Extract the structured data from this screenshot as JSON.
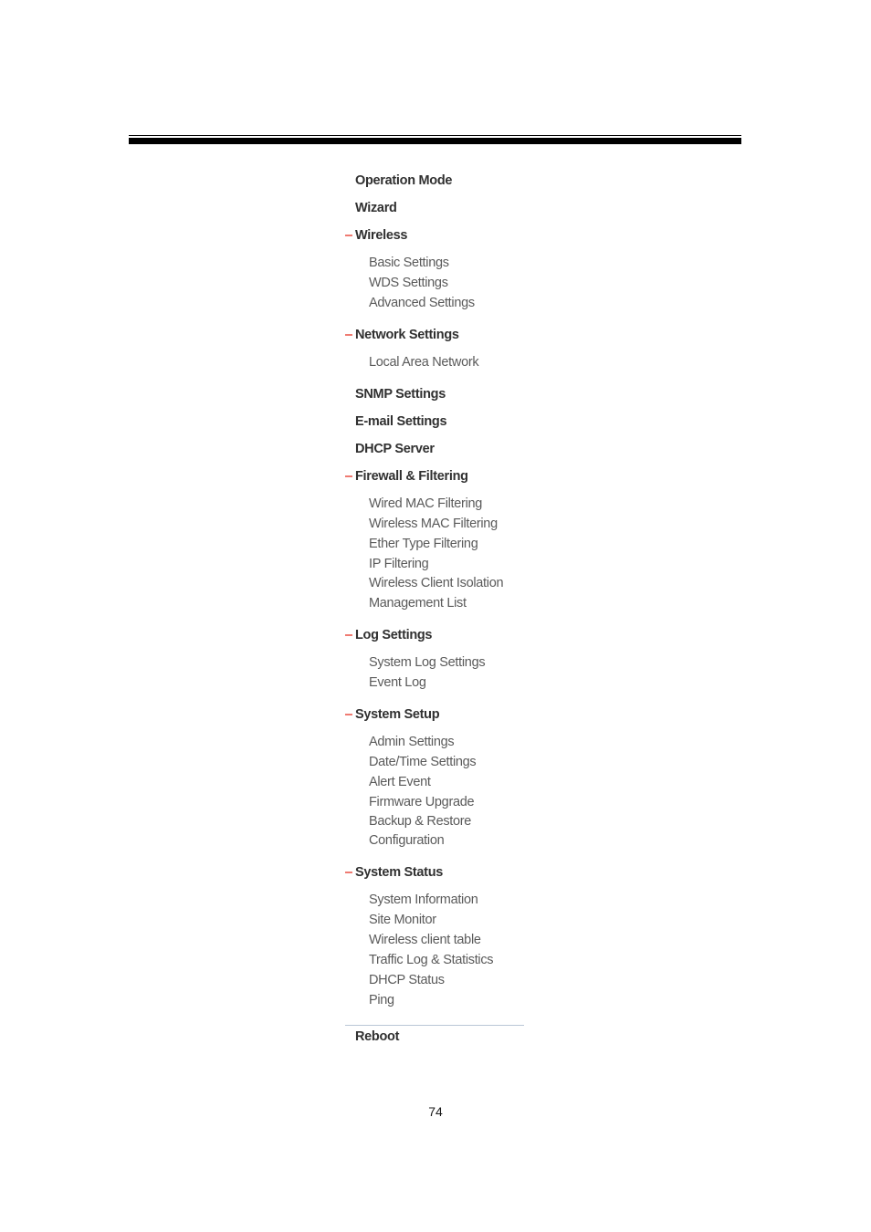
{
  "document": {
    "page_number": "74"
  },
  "colors": {
    "toggle_marker": "#ef7b72",
    "top_item_text": "#303030",
    "sub_item_text": "#5a5a5a",
    "header_rule": "#000000",
    "reboot_rule": "#b9c6d6"
  },
  "menu": {
    "groups": [
      {
        "label": "Operation Mode",
        "toggle": false,
        "children": []
      },
      {
        "label": "Wizard",
        "toggle": false,
        "children": []
      },
      {
        "label": "Wireless",
        "toggle": true,
        "children": [
          "Basic Settings",
          "WDS Settings",
          "Advanced Settings"
        ]
      },
      {
        "label": "Network Settings",
        "toggle": true,
        "children": [
          "Local Area Network"
        ]
      },
      {
        "label": "SNMP Settings",
        "toggle": false,
        "children": []
      },
      {
        "label": "E-mail Settings",
        "toggle": false,
        "children": []
      },
      {
        "label": "DHCP Server",
        "toggle": false,
        "children": []
      },
      {
        "label": "Firewall & Filtering",
        "toggle": true,
        "children": [
          "Wired MAC Filtering",
          "Wireless MAC Filtering",
          "Ether Type Filtering",
          "IP Filtering",
          "Wireless Client Isolation",
          "Management List"
        ]
      },
      {
        "label": "Log Settings",
        "toggle": true,
        "children": [
          "System Log Settings",
          "Event Log"
        ]
      },
      {
        "label": "System Setup",
        "toggle": true,
        "children": [
          "Admin Settings",
          "Date/Time Settings",
          "Alert Event",
          "Firmware Upgrade",
          "Backup & Restore Configuration"
        ]
      },
      {
        "label": "System Status",
        "toggle": true,
        "children": [
          "System Information",
          "Site Monitor",
          "Wireless client table",
          "Traffic Log & Statistics",
          "DHCP Status",
          "Ping"
        ]
      }
    ],
    "footer_item": "Reboot"
  }
}
